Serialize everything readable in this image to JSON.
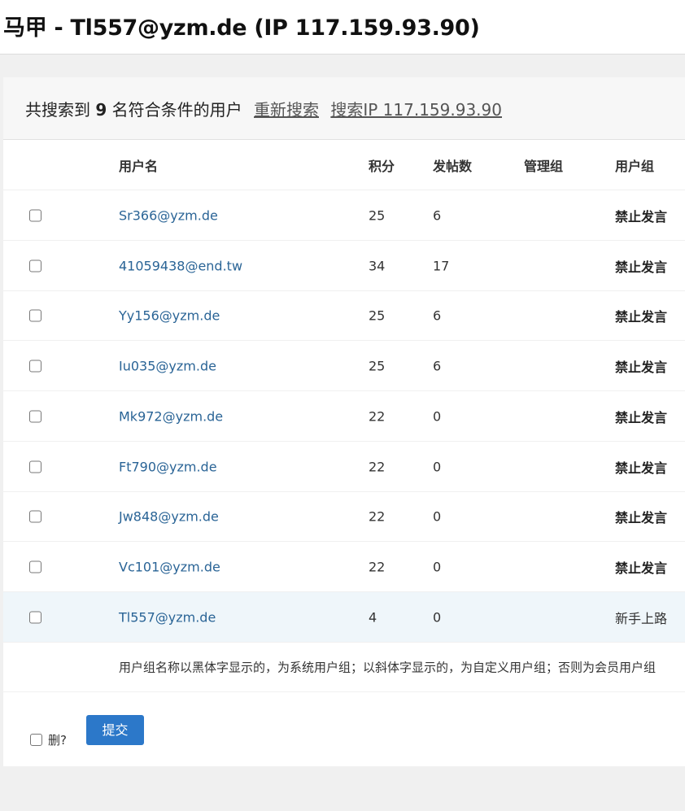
{
  "page": {
    "title": "马甲 - Tl557@yzm.de (IP 117.159.93.90)"
  },
  "summary": {
    "prefix": "共搜索到",
    "count": "9",
    "suffix": "名符合条件的用户",
    "research_link": "重新搜索",
    "search_ip_link": "搜索IP 117.159.93.90"
  },
  "table": {
    "headers": {
      "username": "用户名",
      "credits": "积分",
      "posts": "发帖数",
      "admin_group": "管理组",
      "user_group": "用户组"
    },
    "rows": [
      {
        "username": "Sr366@yzm.de",
        "credits": "25",
        "posts": "6",
        "admin_group": "",
        "user_group": "禁止发言",
        "group_type": "system"
      },
      {
        "username": "41059438@end.tw",
        "credits": "34",
        "posts": "17",
        "admin_group": "",
        "user_group": "禁止发言",
        "group_type": "system"
      },
      {
        "username": "Yy156@yzm.de",
        "credits": "25",
        "posts": "6",
        "admin_group": "",
        "user_group": "禁止发言",
        "group_type": "system"
      },
      {
        "username": "Iu035@yzm.de",
        "credits": "25",
        "posts": "6",
        "admin_group": "",
        "user_group": "禁止发言",
        "group_type": "system"
      },
      {
        "username": "Mk972@yzm.de",
        "credits": "22",
        "posts": "0",
        "admin_group": "",
        "user_group": "禁止发言",
        "group_type": "system"
      },
      {
        "username": "Ft790@yzm.de",
        "credits": "22",
        "posts": "0",
        "admin_group": "",
        "user_group": "禁止发言",
        "group_type": "system"
      },
      {
        "username": "Jw848@yzm.de",
        "credits": "22",
        "posts": "0",
        "admin_group": "",
        "user_group": "禁止发言",
        "group_type": "system"
      },
      {
        "username": "Vc101@yzm.de",
        "credits": "22",
        "posts": "0",
        "admin_group": "",
        "user_group": "禁止发言",
        "group_type": "system"
      },
      {
        "username": "Tl557@yzm.de",
        "credits": "4",
        "posts": "0",
        "admin_group": "",
        "user_group": "新手上路",
        "group_type": "member",
        "highlighted": true
      }
    ],
    "note": "用户组名称以黑体字显示的，为系统用户组；以斜体字显示的，为自定义用户组；否则为会员用户组"
  },
  "footer": {
    "delete_label": "删?",
    "submit_label": "提交"
  },
  "colors": {
    "link": "#2a6496",
    "button": "#2c78c9",
    "highlight_row": "#eff6fa"
  }
}
